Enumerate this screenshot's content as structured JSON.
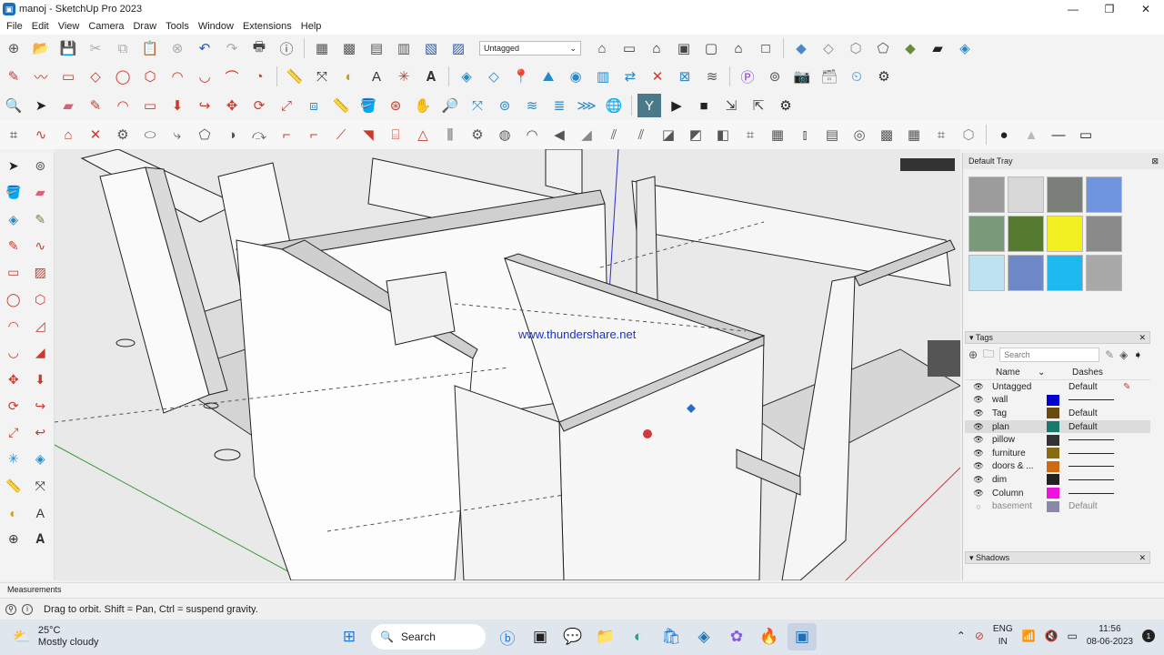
{
  "window": {
    "title": "manoj - SketchUp Pro 2023",
    "minimize": "—",
    "maximize": "❐",
    "close": "✕"
  },
  "menu": [
    "File",
    "Edit",
    "View",
    "Camera",
    "Draw",
    "Tools",
    "Window",
    "Extensions",
    "Help"
  ],
  "toolbar": {
    "tag_select": "Untagged"
  },
  "viewport": {
    "watermark": "www.thundershare.net"
  },
  "tray": {
    "title": "Default Tray",
    "materials": {
      "swatches": [
        "#9b9b9b",
        "#d8d8d8",
        "#7a7f7a",
        "#6f95e0",
        "#7a9a7a",
        "#557a30",
        "#f2f020",
        "#8a8a8a",
        "#bfe2f0",
        "#6f88c8",
        "#1eb8f0",
        "#a8a8a8"
      ]
    },
    "tags": {
      "header": "Tags",
      "search_placeholder": "Search",
      "col_name": "Name",
      "col_dashes": "Dashes",
      "rows": [
        {
          "name": "Untagged",
          "color": "",
          "dashes": "Default"
        },
        {
          "name": "wall",
          "color": "#0000d0",
          "dashes": ""
        },
        {
          "name": "Tag",
          "color": "#6b4a10",
          "dashes": "Default"
        },
        {
          "name": "plan",
          "color": "#1a7a6a",
          "dashes": "Default"
        },
        {
          "name": "pillow",
          "color": "#333333",
          "dashes": ""
        },
        {
          "name": "furniture",
          "color": "#8a6a10",
          "dashes": ""
        },
        {
          "name": "doors & ...",
          "color": "#d06a10",
          "dashes": ""
        },
        {
          "name": "dim",
          "color": "#222222",
          "dashes": ""
        },
        {
          "name": "Column",
          "color": "#f010e0",
          "dashes": ""
        },
        {
          "name": "basement",
          "color": "#8a8aa8",
          "dashes": "Default"
        }
      ]
    },
    "shadows": {
      "header": "Shadows"
    }
  },
  "measurements": {
    "label": "Measurements"
  },
  "status": {
    "text": "Drag to orbit. Shift = Pan, Ctrl = suspend gravity."
  },
  "taskbar": {
    "weather_temp": "25°C",
    "weather_desc": "Mostly cloudy",
    "search_label": "Search",
    "lang1": "ENG",
    "lang2": "IN",
    "time": "11:56",
    "date": "08-06-2023",
    "notification_count": "1"
  }
}
